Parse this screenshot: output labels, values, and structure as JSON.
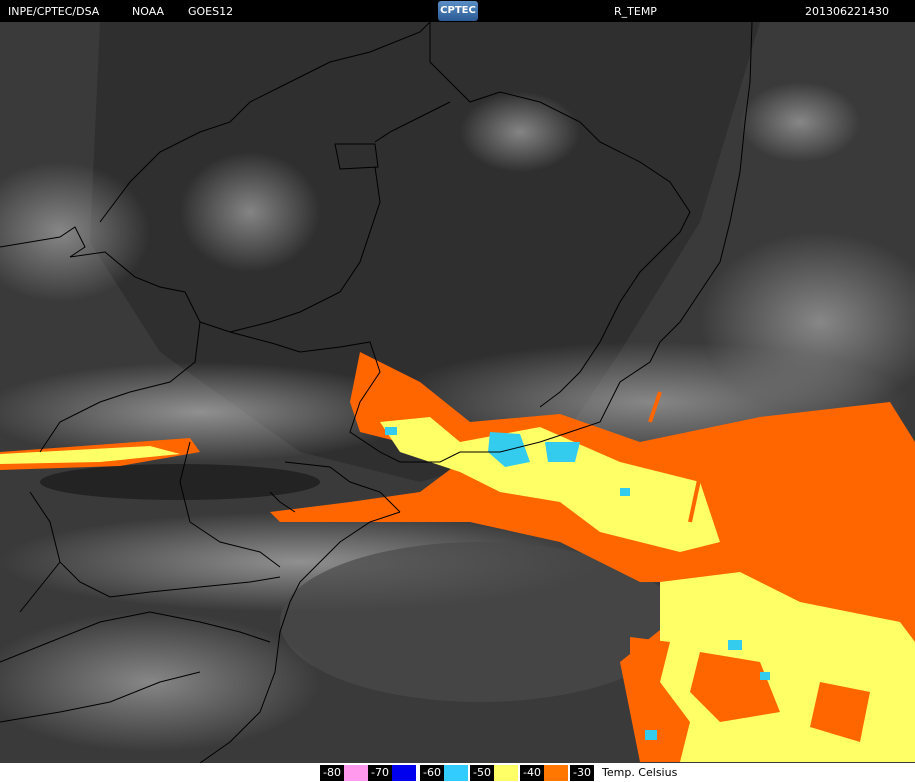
{
  "header": {
    "source": "INPE/CPTEC/DSA",
    "agency": "NOAA",
    "satellite": "GOES12",
    "logo_text": "CPTEC",
    "product": "R_TEMP",
    "timestamp": "201306221430"
  },
  "legend": {
    "items": [
      {
        "label": "-80",
        "color": "#ff99ee"
      },
      {
        "label": "-70",
        "color": "#0000ee"
      },
      {
        "label": "-60",
        "color": "#33ccff"
      },
      {
        "label": "-50",
        "color": "#ffff66"
      },
      {
        "label": "-40",
        "color": "#ff7700"
      },
      {
        "label": "-30",
        "color": "#ffffff"
      }
    ],
    "unit": "Temp. Celsius"
  },
  "colors": {
    "cold_yellow": "#ffff66",
    "orange": "#ff6600",
    "cyan": "#33ccee",
    "boundaries": "#000000"
  }
}
